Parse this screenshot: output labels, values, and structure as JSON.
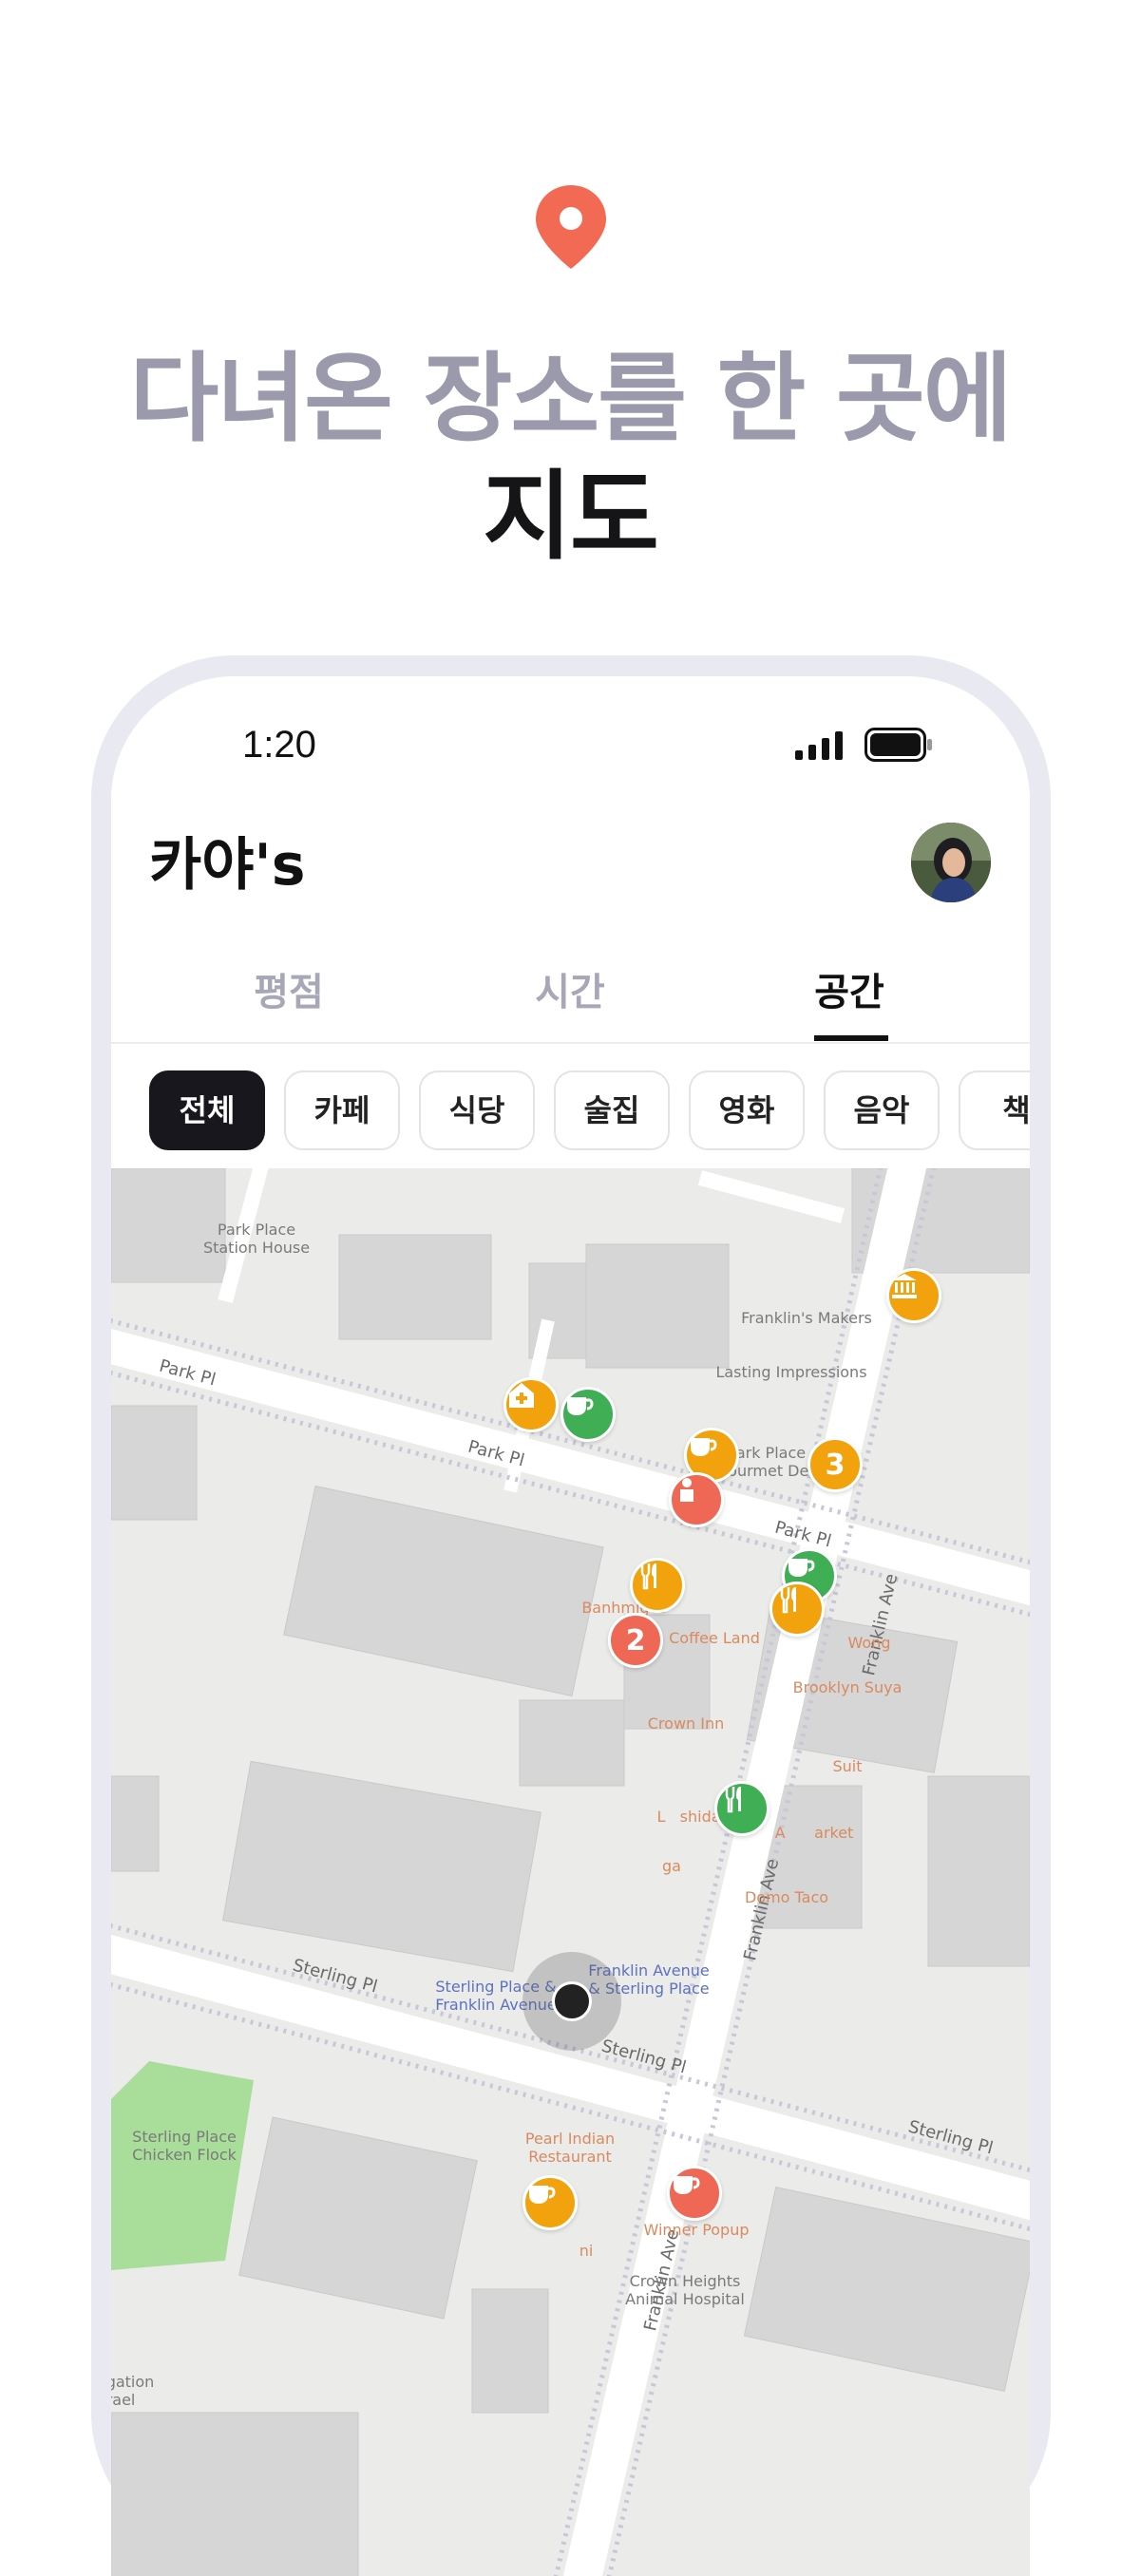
{
  "hero": {
    "pin_icon": "location-pin-icon",
    "accent": "#f26a54",
    "line1": "다녀온 장소를 한 곳에",
    "line2": "지도"
  },
  "status_bar": {
    "time": "1:20",
    "signal_icon": "signal-icon",
    "battery_icon": "battery-icon"
  },
  "header": {
    "title": "카야's",
    "avatar_icon": "avatar"
  },
  "tabs": [
    {
      "label": "평점",
      "active": false
    },
    {
      "label": "시간",
      "active": false
    },
    {
      "label": "공간",
      "active": true
    }
  ],
  "categories": [
    {
      "label": "전체",
      "active": true
    },
    {
      "label": "카페",
      "active": false
    },
    {
      "label": "식당",
      "active": false
    },
    {
      "label": "술집",
      "active": false
    },
    {
      "label": "영화",
      "active": false
    },
    {
      "label": "음악",
      "active": false
    },
    {
      "label": "책",
      "active": false
    }
  ],
  "map": {
    "streets": {
      "park_1": "Park Pl",
      "park_2": "Park Pl",
      "park_3": "Park Pl",
      "sterling_1": "Sterling Pl",
      "sterling_2": "Sterling Pl",
      "sterling_3": "Sterling Pl",
      "franklin_1": "Franklin Ave",
      "franklin_2": "Franklin Ave",
      "franklin_3": "Franklin Ave"
    },
    "pois": {
      "station_house": "Park Place\nStation House",
      "franklins_makers": "Franklin's Makers",
      "lasting_impressions": "Lasting Impressions",
      "gourmet_deli": "Park Place\nGourmet Deli",
      "banhmigos": "Banhmigos",
      "coffee_land": "Coffee Land",
      "wong": "Wong",
      "brooklyn_suya": "Brooklyn Suya",
      "crown_inn": "Crown Inn",
      "suit": "Suit",
      "l_shida": "L   shida",
      "market": "A      arket",
      "ga": "ga",
      "domo_taco": "Domo Taco",
      "sterling_station": "Sterling Place &\nFranklin Avenue",
      "franklin_station": "Franklin Avenue\n& Sterling Place",
      "chicken_flock": "Sterling Place\nChicken Flock",
      "pearl_indian": "Pearl Indian\nRestaurant",
      "winner_popup": "Winner Popup",
      "animal_hospital": "Crown Heights\nAnimal Hospital",
      "ni": "ni",
      "gation": "gation\nrael"
    },
    "markers": [
      {
        "name": "museum-marker",
        "color": "orange",
        "icon": "museum-icon"
      },
      {
        "name": "hospital-marker",
        "color": "orange",
        "icon": "hospital-icon"
      },
      {
        "name": "cafe-marker-1",
        "color": "green",
        "icon": "coffee-cup-icon"
      },
      {
        "name": "cafe-marker-2",
        "color": "orange",
        "icon": "coffee-cup-icon"
      },
      {
        "name": "cluster-marker-3",
        "color": "orange",
        "count": "3"
      },
      {
        "name": "person-marker",
        "color": "red",
        "icon": "person-icon"
      },
      {
        "name": "restaurant-marker-1",
        "color": "orange",
        "icon": "fork-knife-icon"
      },
      {
        "name": "cafe-marker-3",
        "color": "green",
        "icon": "coffee-cup-icon"
      },
      {
        "name": "restaurant-marker-2",
        "color": "orange",
        "icon": "fork-knife-icon"
      },
      {
        "name": "cluster-marker-2",
        "color": "red",
        "count": "2"
      },
      {
        "name": "restaurant-marker-3",
        "color": "green",
        "icon": "fork-knife-icon"
      },
      {
        "name": "cafe-marker-4",
        "color": "orange",
        "icon": "coffee-cup-icon"
      },
      {
        "name": "cafe-marker-5",
        "color": "red",
        "icon": "coffee-cup-icon"
      }
    ],
    "location_icon": "current-location-icon"
  }
}
